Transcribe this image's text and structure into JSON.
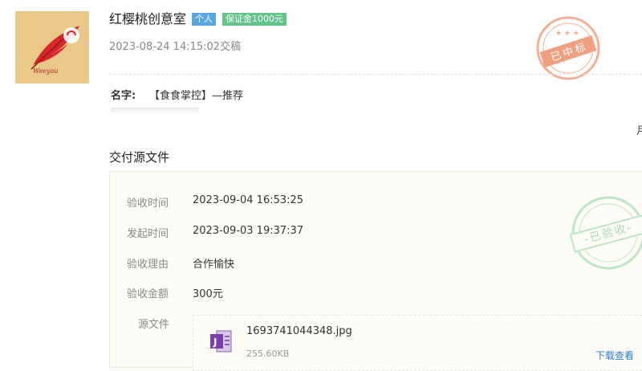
{
  "header": {
    "studio_name": "红樱桃创意室",
    "badge_personal": "个人",
    "badge_deposit": "保证金1000元",
    "submit_time": "2023-08-24 14:15:02交稿",
    "stamp_awarded": "已中标",
    "avatar_text": "Weeyou",
    "colors": {
      "badge_personal": "#5aa6e0",
      "badge_deposit": "#63c48a",
      "stamp_awarded": "#f0a080"
    }
  },
  "submission": {
    "name_label": "名字:",
    "name_value": "【食食掌控】—推荐",
    "edge_char": "月"
  },
  "delivery": {
    "section_title": "交付源文件",
    "rows": [
      {
        "label": "验收时间",
        "value": "2023-09-04 16:53:25"
      },
      {
        "label": "发起时间",
        "value": "2023-09-03 19:37:37"
      },
      {
        "label": "验收理由",
        "value": "合作愉快"
      },
      {
        "label": "验收金额",
        "value": "300元"
      }
    ],
    "source_label": "源文件",
    "file": {
      "name": "1693741044348.jpg",
      "size": "255.60KB",
      "download_label": "下载查看",
      "icon": "onenote-file-icon"
    },
    "stamp_accepted": "-已验收-",
    "colors": {
      "stamp_accepted": "#a8dcb0",
      "link": "#2d7fd3"
    }
  }
}
